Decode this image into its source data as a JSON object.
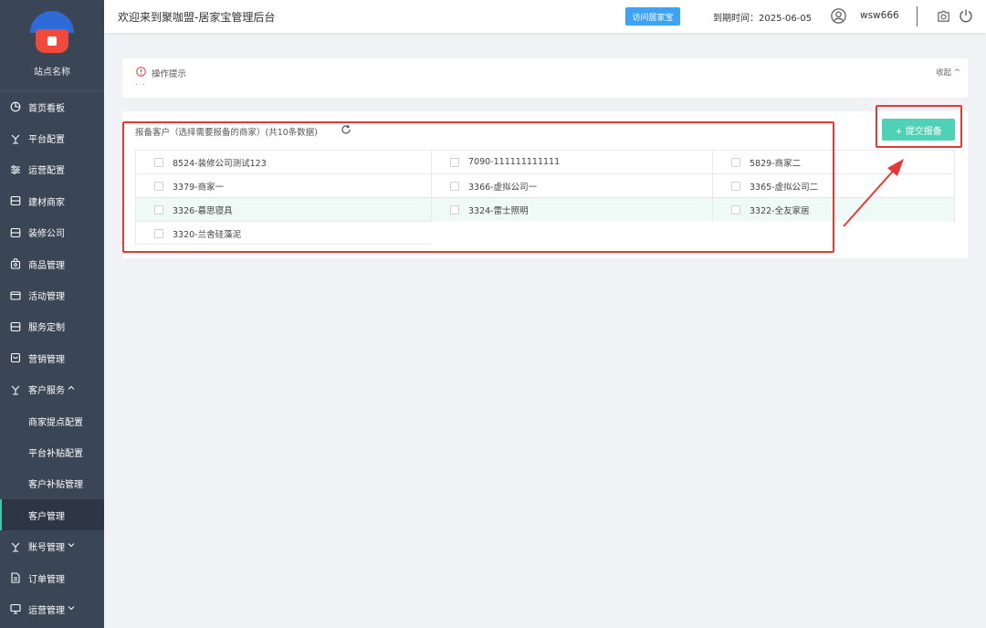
{
  "sidebar": {
    "site_name": "站点名称",
    "items": [
      {
        "label": "首页看板",
        "icon": "dashboard-icon"
      },
      {
        "label": "平台配置",
        "icon": "config-icon"
      },
      {
        "label": "运营配置",
        "icon": "sliders-icon"
      },
      {
        "label": "建材商家",
        "icon": "store-icon"
      },
      {
        "label": "装修公司",
        "icon": "store-icon"
      },
      {
        "label": "商品管理",
        "icon": "bag-icon"
      },
      {
        "label": "活动管理",
        "icon": "card-icon"
      },
      {
        "label": "服务定制",
        "icon": "store-icon"
      },
      {
        "label": "营销管理",
        "icon": "gift-icon"
      },
      {
        "label": "客户服务",
        "icon": "config-icon",
        "chevron": "^"
      },
      {
        "label": "商家提点配置",
        "sub": true
      },
      {
        "label": "平台补贴配置",
        "sub": true
      },
      {
        "label": "客户补贴管理",
        "sub": true
      },
      {
        "label": "客户管理",
        "sub": true,
        "active": true
      },
      {
        "label": "账号管理",
        "icon": "config-icon",
        "chevron": "v"
      },
      {
        "label": "订单管理",
        "icon": "doc-icon"
      },
      {
        "label": "运营管理",
        "icon": "monitor-icon",
        "chevron": "v"
      }
    ]
  },
  "header": {
    "welcome": "欢迎来到聚咖盟-居家宝管理后台",
    "visit_button": "访问居家宝",
    "expire": "到期时间：2025-06-05",
    "username": "wsw666"
  },
  "tips": {
    "title": "操作提示",
    "dots": ". .",
    "collapse": "收起 ^"
  },
  "panel": {
    "title": "报备客户（选择需要报备的商家）(共10条数据)",
    "submit_button": "+ 提交报备",
    "rows": [
      [
        "8524-装修公司测试123",
        "7090-111111111111",
        "5829-商家二"
      ],
      [
        "3379-商家一",
        "3366-虚拟公司一",
        "3365-虚拟公司二"
      ],
      [
        "3326-慕思寝具",
        "3324-雷士照明",
        "3322-全友家居"
      ],
      [
        "3320-兰舍硅藻泥",
        "",
        ""
      ]
    ]
  },
  "colors": {
    "sidebar_bg": "#3a4556",
    "accent": "#4fd1b5",
    "visit_button": "#3ea2f5",
    "annotation": "#e53935"
  }
}
